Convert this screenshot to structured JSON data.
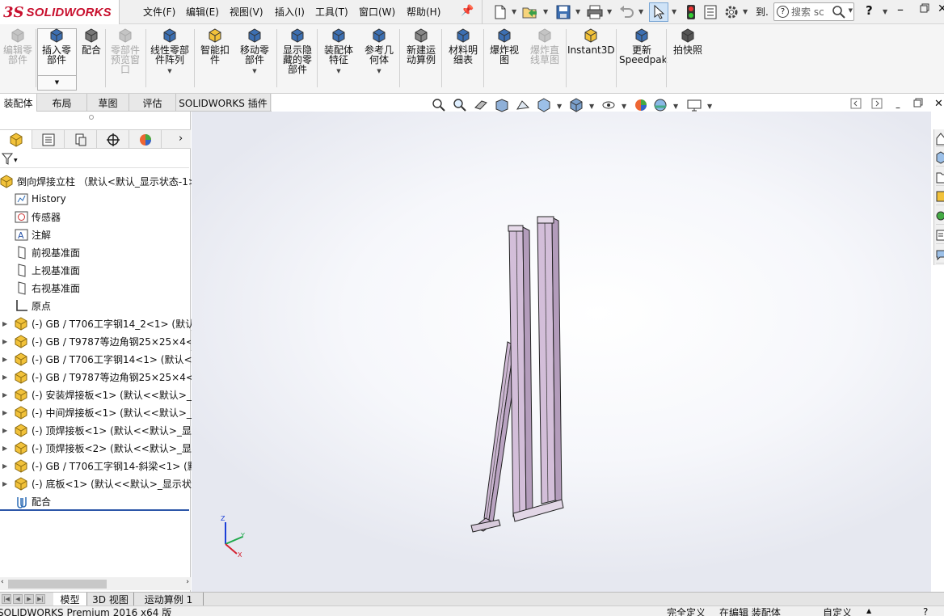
{
  "app": {
    "brand_ds": "3S",
    "brand_name": "SOLIDWORKS"
  },
  "menu": [
    "文件(F)",
    "编辑(E)",
    "视图(V)",
    "插入(I)",
    "工具(T)",
    "窗口(W)",
    "帮助(H)"
  ],
  "quick_access": {
    "truncated_label": "到.",
    "search_placeholder": "搜索 sc"
  },
  "command_manager": [
    {
      "label": "编辑零\n部件",
      "disabled": true
    },
    {
      "label": "插入零\n部件",
      "disabled": false
    },
    {
      "label": "配合",
      "disabled": false
    },
    {
      "label": "零部件\n预览窗\n口",
      "disabled": true
    },
    {
      "label": "线性零部\n件阵列",
      "disabled": false
    },
    {
      "label": "智能扣\n件",
      "disabled": false
    },
    {
      "label": "移动零\n部件",
      "disabled": false
    },
    {
      "label": "显示隐\n藏的零\n部件",
      "disabled": false
    },
    {
      "label": "装配体\n特征",
      "disabled": false
    },
    {
      "label": "参考几\n何体",
      "disabled": false
    },
    {
      "label": "新建运\n动算例",
      "disabled": false
    },
    {
      "label": "材料明\n细表",
      "disabled": false
    },
    {
      "label": "爆炸视\n图",
      "disabled": false
    },
    {
      "label": "爆炸直\n线草图",
      "disabled": true
    },
    {
      "label": "Instant3D",
      "disabled": false
    },
    {
      "label": "更新\nSpeedpak",
      "disabled": false
    },
    {
      "label": "拍快照",
      "disabled": false
    }
  ],
  "cm_tabs": [
    "装配体",
    "布局",
    "草图",
    "评估",
    "SOLIDWORKS 插件"
  ],
  "tree": {
    "root": "倒向焊接立柱 （默认<默认_显示状态-1>",
    "items": [
      {
        "label": "History",
        "icon": "history-icon",
        "expand": false
      },
      {
        "label": "传感器",
        "icon": "sensor-icon",
        "expand": false
      },
      {
        "label": "注解",
        "icon": "annotation-icon",
        "expand": false
      },
      {
        "label": "前视基准面",
        "icon": "plane-icon",
        "expand": false
      },
      {
        "label": "上视基准面",
        "icon": "plane-icon",
        "expand": false
      },
      {
        "label": "右视基准面",
        "icon": "plane-icon",
        "expand": false
      },
      {
        "label": "原点",
        "icon": "origin-icon",
        "expand": false
      },
      {
        "label": "(-) GB / T706工字钢14_2<1> (默认",
        "icon": "part-icon",
        "expand": true
      },
      {
        "label": "(-) GB / T9787等边角钢25×25×4<",
        "icon": "part-icon",
        "expand": true
      },
      {
        "label": "(-) GB / T706工字钢14<1> (默认<",
        "icon": "part-icon",
        "expand": true
      },
      {
        "label": "(-) GB / T9787等边角钢25×25×4<",
        "icon": "part-icon",
        "expand": true
      },
      {
        "label": "(-) 安装焊接板<1> (默认<<默认>_",
        "icon": "part-icon",
        "expand": true
      },
      {
        "label": "(-) 中间焊接板<1> (默认<<默认>_",
        "icon": "part-icon",
        "expand": true
      },
      {
        "label": "(-) 顶焊接板<1> (默认<<默认>_显",
        "icon": "part-icon",
        "expand": true
      },
      {
        "label": "(-) 顶焊接板<2> (默认<<默认>_显",
        "icon": "part-icon",
        "expand": true
      },
      {
        "label": "(-) GB / T706工字钢14-斜梁<1> (默",
        "icon": "part-icon",
        "expand": true
      },
      {
        "label": "(-) 底板<1> (默认<<默认>_显示状",
        "icon": "part-icon",
        "expand": true
      },
      {
        "label": "配合",
        "icon": "mates-icon",
        "expand": false
      }
    ]
  },
  "bottom_tabs": [
    "模型",
    "3D 视图",
    "运动算例 1"
  ],
  "status": {
    "product": "SOLIDWORKS Premium 2016 x64 版",
    "definition": "完全定义",
    "editing": "在编辑 装配体",
    "units": "自定义"
  },
  "triad": {
    "x": "X",
    "y": "Y",
    "z": "Z"
  },
  "colors": {
    "accent": "#2c6bb5",
    "brand": "#c8102e",
    "part_face": "#cdb7d3",
    "part_edge": "#222222",
    "part_icon": "#f2c23a"
  }
}
